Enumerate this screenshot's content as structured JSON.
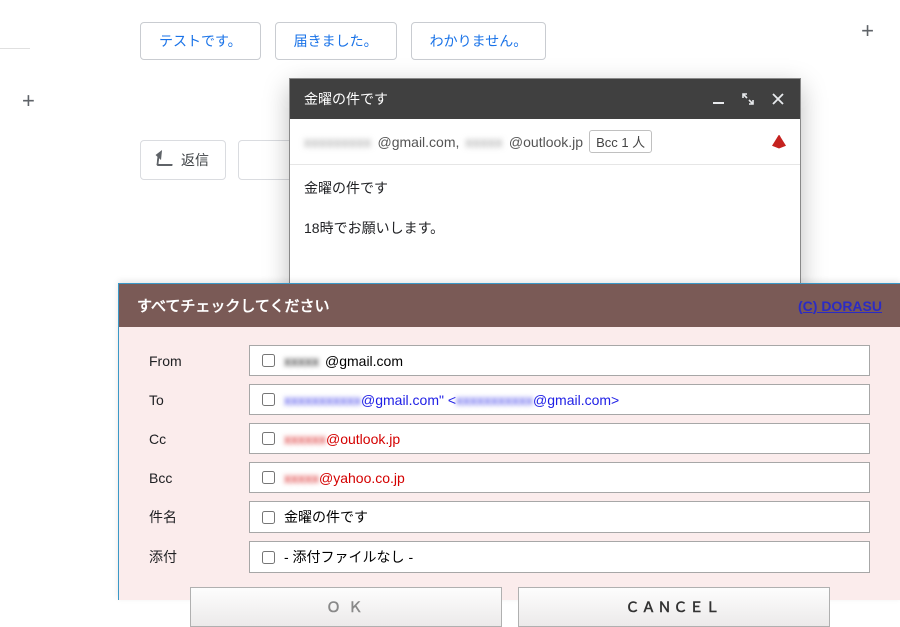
{
  "chips": [
    "テストです。",
    "届きました。",
    "わかりません。"
  ],
  "reply_label": "返信",
  "compose": {
    "title": "金曜の件です",
    "to_parts": {
      "a_blur": "xxxxxxxxx",
      "a_domain": "@gmail.com,",
      "b_blur": "xxxxx",
      "b_domain": "@outlook.jp"
    },
    "bcc_badge": "Bcc 1 人",
    "subject": "金曜の件です",
    "body": "18時でお願いします。"
  },
  "verify": {
    "heading": "すべてチェックしてください",
    "credit": "(C) DORASU",
    "rows": {
      "from": {
        "label": "From",
        "blur": "xxxxx",
        "rest": "@gmail.com"
      },
      "to": {
        "label": "To",
        "blur": "xxxxxxxxxxx",
        "mid": "@gmail.com\" <",
        "blur2": "xxxxxxxxxxx",
        "rest": "@gmail.com>"
      },
      "cc": {
        "label": "Cc",
        "blur": "xxxxxx",
        "rest": "@outlook.jp"
      },
      "bcc": {
        "label": "Bcc",
        "blur": "xxxxx",
        "rest": "@yahoo.co.jp"
      },
      "subject": {
        "label": "件名",
        "value": "金曜の件です"
      },
      "attach": {
        "label": "添付",
        "value": "- 添付ファイルなし -"
      }
    },
    "ok": "Ｏ Ｋ",
    "cancel": "ＣＡＮＣＥＬ"
  }
}
